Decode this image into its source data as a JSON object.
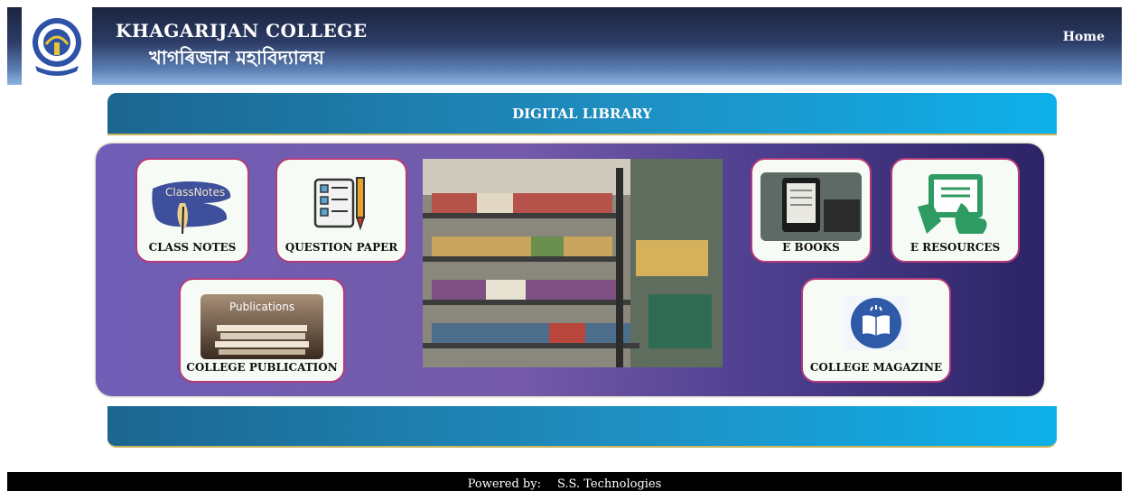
{
  "header": {
    "college_name": "KHAGARIJAN COLLEGE",
    "college_name_local": "খাগৰিজান মহাবিদ্যালয়",
    "home_label": "Home"
  },
  "banner": {
    "title": "DIGITAL LIBRARY"
  },
  "tiles": {
    "class_notes": {
      "label": "CLASS NOTES",
      "image_text": "ClassNotes",
      "icon": "class-notes-icon"
    },
    "question_paper": {
      "label": "QUESTION PAPER",
      "icon": "question-paper-icon"
    },
    "college_publication": {
      "label": "COLLEGE PUBLICATION",
      "image_text": "Publications",
      "icon": "publications-icon"
    },
    "e_books": {
      "label": "E BOOKS",
      "icon": "ebook-reader-icon"
    },
    "e_resources": {
      "label": "E RESOURCES",
      "icon": "tablet-touch-icon"
    },
    "college_magazine": {
      "label": "COLLEGE MAGAZINE",
      "icon": "open-book-icon"
    }
  },
  "footer": {
    "powered_by_label": "Powered by:",
    "company": "S.S. Technologies"
  },
  "colors": {
    "header_dark": "#1b2440",
    "banner_blue": "#1f8fc2",
    "panel_purple": "#6f5fb7",
    "card_border": "#b43a7a",
    "magazine_blue": "#2e5aa8"
  }
}
